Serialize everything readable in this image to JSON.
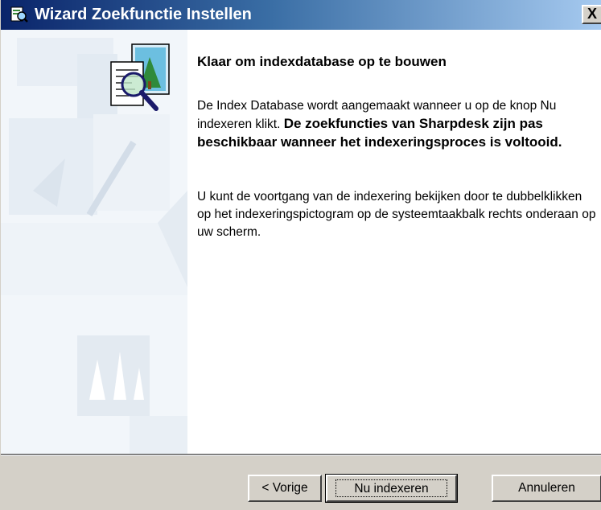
{
  "window": {
    "title": "Wizard Zoekfunctie Instellen",
    "close_label": "X",
    "title_bar_color": "#0a246a"
  },
  "main": {
    "heading": "Klaar om indexdatabase op te bouwen",
    "paragraph1_normal": "De Index Database wordt aangemaakt wanneer u op de knop Nu indexeren klikt. ",
    "paragraph1_bold": "De zoekfuncties van Sharpdesk zijn pas beschikbaar wanneer het indexeringsproces is voltooid.",
    "paragraph2": "U kunt de voortgang van de indexering bekijken door te dubbelklikken op het indexeringspictogram op de systeemtaakbalk rechts onderaan op uw scherm."
  },
  "buttons": {
    "back": "< Vorige",
    "index_now": "Nu indexeren",
    "cancel": "Annuleren"
  },
  "icons": {
    "title_icon": "wizard-search-icon",
    "hero_icon": "document-magnifier-icon",
    "side_art": "decorative-watermark-art"
  }
}
